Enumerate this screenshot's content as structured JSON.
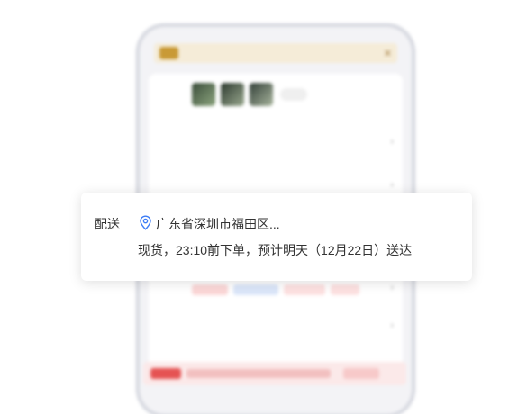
{
  "popup": {
    "label": "配送",
    "address": "广东省深圳市福田区...",
    "delivery_info": "现货，23:10前下单，预计明天（12月22日）送达"
  },
  "colors": {
    "location_icon": "#3e7df6",
    "text": "#333333",
    "accent_red": "#e55353",
    "promo_gold": "#c99a36"
  },
  "icons": {
    "location": "location-pin-icon"
  }
}
